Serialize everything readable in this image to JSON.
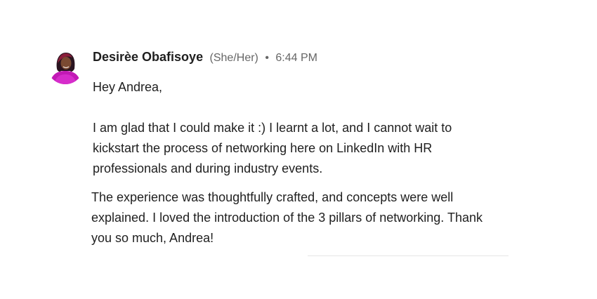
{
  "message": {
    "sender_name": "Desirèe Obafisoye",
    "pronouns": "(She/Her)",
    "separator": "•",
    "timestamp": "6:44 PM",
    "greeting": "Hey Andrea,",
    "paragraphs": [
      "I am glad that I could make it :) I learnt a lot, and I cannot wait to kickstart the process of networking here on LinkedIn with HR professionals and during industry events.",
      "The experience was thoughtfully crafted, and concepts were well explained. I loved the introduction of the 3 pillars of networking. Thank you so much, Andrea!"
    ]
  },
  "colors": {
    "text": "#1f1f1f",
    "meta": "#666666",
    "avatar_accent": "#c21ab5"
  },
  "icons": {
    "avatar": "profile-photo-avatar"
  }
}
